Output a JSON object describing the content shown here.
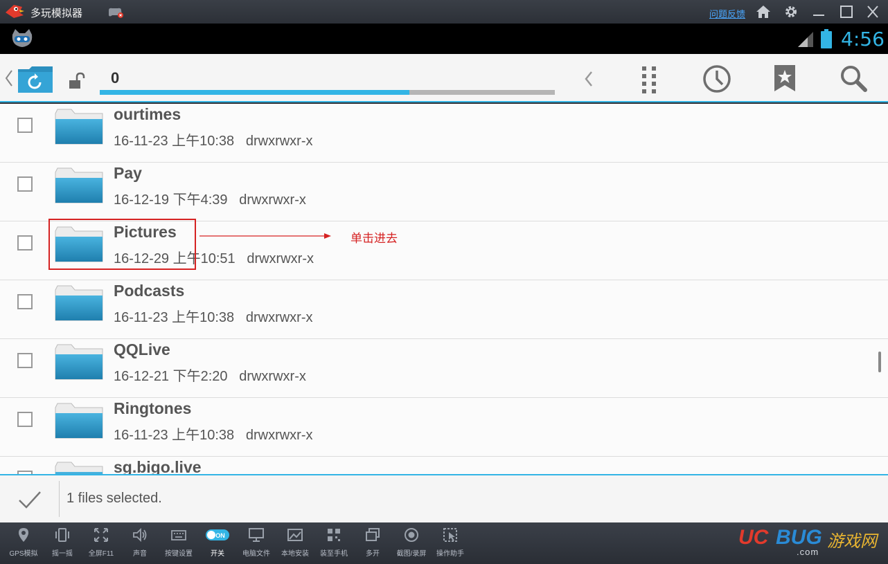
{
  "emulator": {
    "title": "多玩模拟器",
    "feedback_link": "问题反馈"
  },
  "statusbar": {
    "time": "4:56"
  },
  "actionbar": {
    "path": "0",
    "progress_fraction": 0.68
  },
  "files": [
    {
      "name": "ourtimes",
      "meta": "16-11-23 上午10:38   drwxrwxr-x"
    },
    {
      "name": "Pay",
      "meta": "16-12-19 下午4:39   drwxrwxr-x"
    },
    {
      "name": "Pictures",
      "meta": "16-12-29 上午10:51   drwxrwxr-x"
    },
    {
      "name": "Podcasts",
      "meta": "16-11-23 上午10:38   drwxrwxr-x"
    },
    {
      "name": "QQLive",
      "meta": "16-12-21 下午2:20   drwxrwxr-x"
    },
    {
      "name": "Ringtones",
      "meta": "16-11-23 上午10:38   drwxrwxr-x"
    },
    {
      "name": "sg.bigo.live",
      "meta": ""
    }
  ],
  "annotation": {
    "text": "单击进去"
  },
  "selection": {
    "status": "1 files selected."
  },
  "toolbar": [
    {
      "label": "GPS模拟",
      "icon": "location-pin-icon"
    },
    {
      "label": "摇一摇",
      "icon": "shake-icon"
    },
    {
      "label": "全屏F11",
      "icon": "fullscreen-icon"
    },
    {
      "label": "声音",
      "icon": "volume-icon"
    },
    {
      "label": "按键设置",
      "icon": "keyboard-icon"
    },
    {
      "label": "开关",
      "icon": "toggle-on-icon",
      "toggle_text": "ON"
    },
    {
      "label": "电脑文件",
      "icon": "monitor-icon"
    },
    {
      "label": "本地安装",
      "icon": "install-icon"
    },
    {
      "label": "装至手机",
      "icon": "qr-code-icon"
    },
    {
      "label": "多开",
      "icon": "multi-window-icon"
    },
    {
      "label": "截图/录屏",
      "icon": "record-icon"
    },
    {
      "label": "操作助手",
      "icon": "assistant-icon"
    }
  ],
  "watermark": {
    "uc": "UC",
    "bug": "BUG",
    "cn": "游戏网",
    "url": ".com"
  },
  "colors": {
    "accent": "#33b5e5",
    "folder": "#2b8fbf",
    "annotation": "#d52222"
  }
}
